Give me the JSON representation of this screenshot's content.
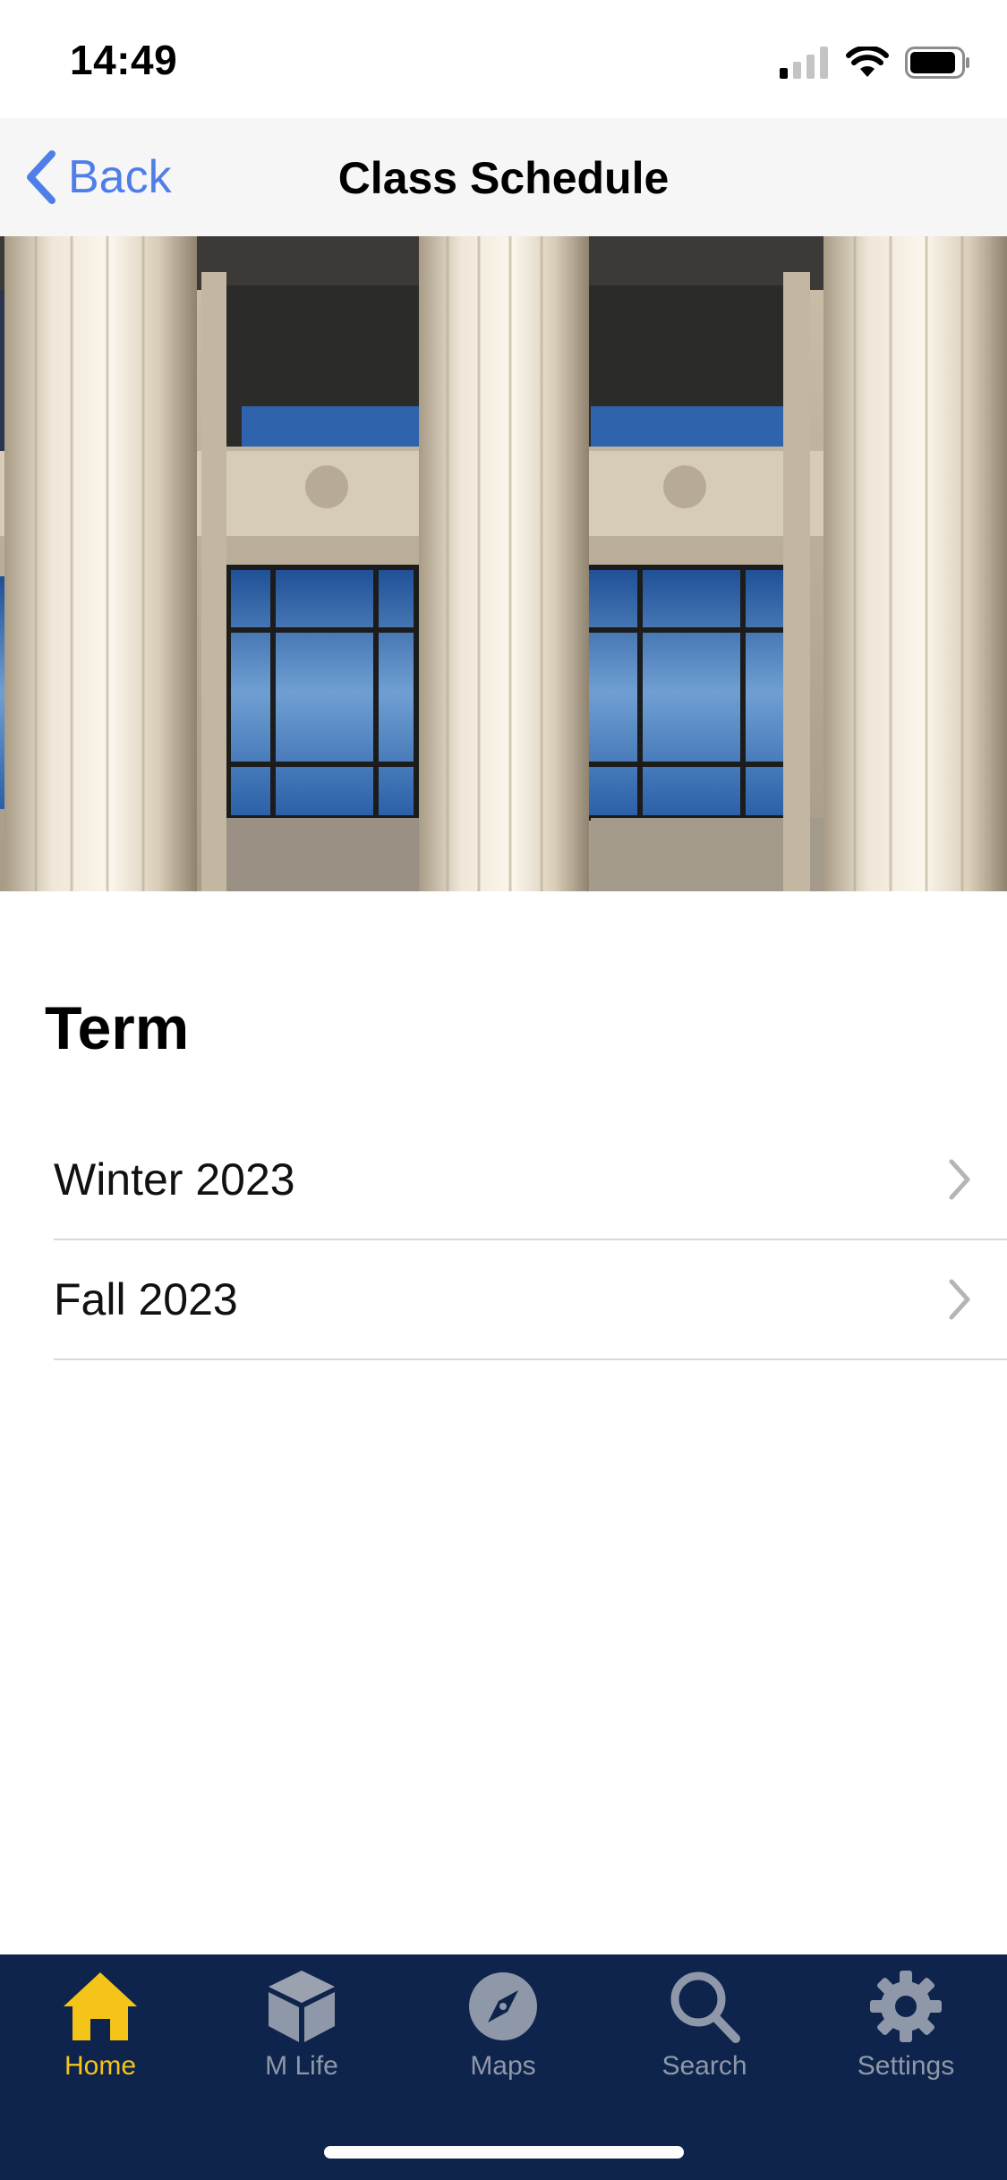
{
  "status_bar": {
    "time": "14:49"
  },
  "nav": {
    "back_label": "Back",
    "title": "Class Schedule"
  },
  "section": {
    "title": "Term"
  },
  "terms": [
    {
      "label": "Winter 2023"
    },
    {
      "label": "Fall 2023"
    }
  ],
  "tabs": [
    {
      "label": "Home",
      "icon": "home-icon",
      "active": true
    },
    {
      "label": "M Life",
      "icon": "cube-icon",
      "active": false
    },
    {
      "label": "Maps",
      "icon": "compass-icon",
      "active": false
    },
    {
      "label": "Search",
      "icon": "search-icon",
      "active": false
    },
    {
      "label": "Settings",
      "icon": "gear-icon",
      "active": false
    }
  ],
  "colors": {
    "accent": "#4f7ee8",
    "tab_bar_bg": "#0e244c",
    "tab_active": "#f4c419",
    "tab_inactive": "#8f98a8"
  }
}
